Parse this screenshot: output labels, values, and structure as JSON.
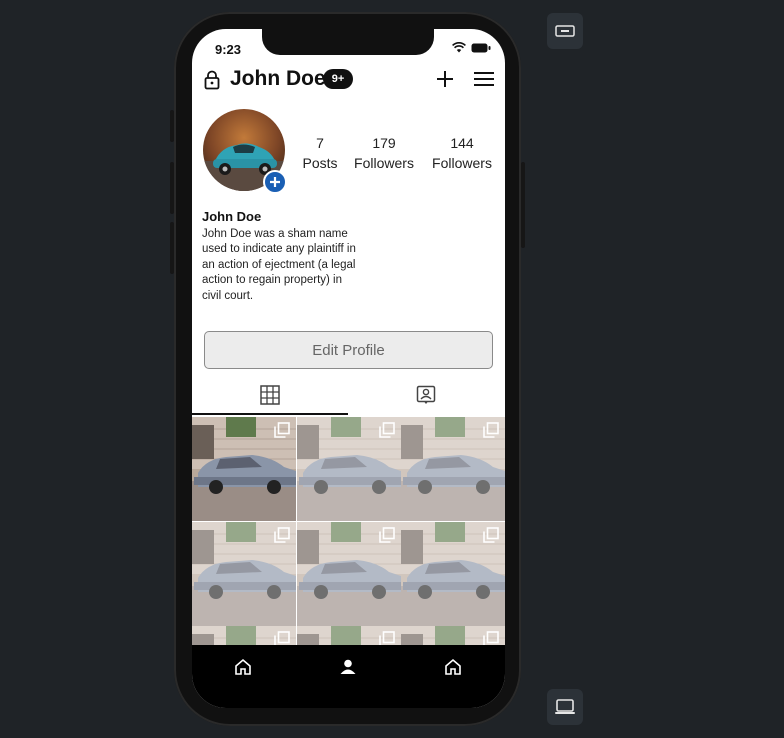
{
  "status_bar": {
    "time": "9:23"
  },
  "header": {
    "username": "John Doe",
    "notification_badge": "9+"
  },
  "stats": [
    {
      "value": "7",
      "label": "Posts"
    },
    {
      "value": "179",
      "label": "Followers"
    },
    {
      "value": "144",
      "label": "Followers"
    }
  ],
  "bio": {
    "name": "John Doe",
    "text": "John Doe was a sham name used to indicate any plaintiff in an action of ejectment (a legal action to regain property) in civil court."
  },
  "edit_profile_label": "Edit Profile",
  "tabs": [
    {
      "icon": "grid-icon",
      "active": true
    },
    {
      "icon": "tagged-person-icon",
      "active": false
    }
  ],
  "tab_bar": [
    {
      "icon": "home-icon"
    },
    {
      "icon": "person-icon"
    },
    {
      "icon": "home-icon"
    }
  ],
  "side_controls": [
    {
      "icon": "rotate-landscape-icon"
    },
    {
      "icon": "laptop-icon"
    }
  ],
  "colors": {
    "accent": "#1a5fb4",
    "background": "#1f2327",
    "tab_bar": "#000000"
  }
}
